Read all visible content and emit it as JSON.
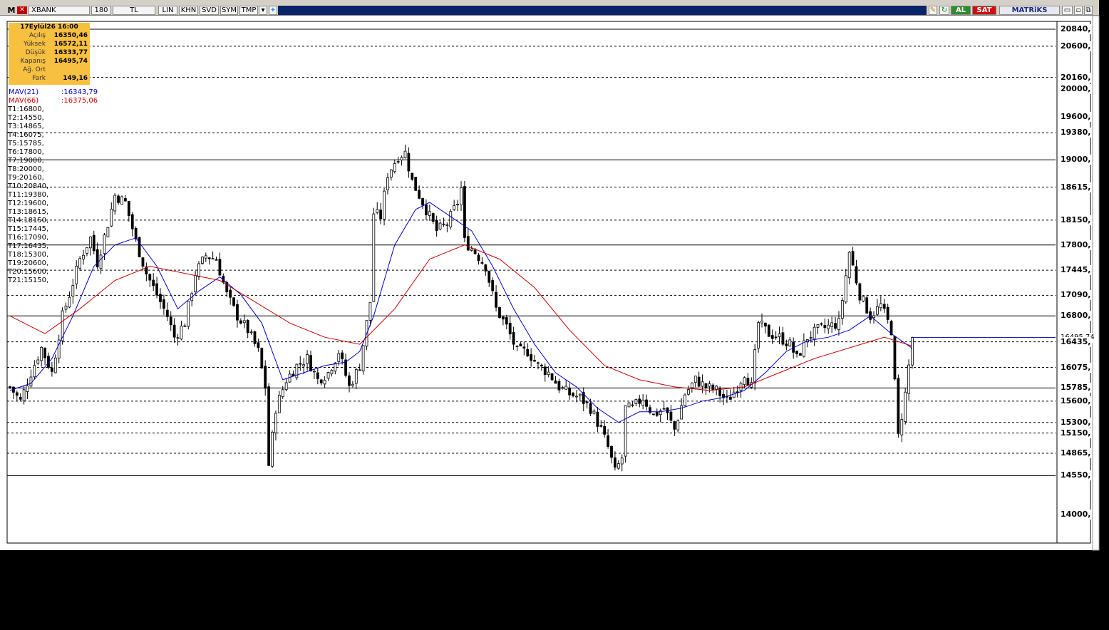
{
  "toolbar": {
    "app_letter": "M",
    "symbol": "XBANK",
    "period": "180",
    "currency": "TL",
    "buttons": [
      "LIN",
      "KHN",
      "SVD",
      "SYM",
      "TMP"
    ],
    "buy_label": "AL",
    "sell_label": "SAT",
    "brand": "MATRiKS"
  },
  "info": {
    "date": "17Eylül26 16:00",
    "rows": [
      {
        "label": "Açılış",
        "value": "16350,46"
      },
      {
        "label": "Yüksek",
        "value": "16572,11"
      },
      {
        "label": "Düşük",
        "value": "16333,77"
      },
      {
        "label": "Kapanış",
        "value": "16495,74"
      },
      {
        "label": "Ağ. Ort",
        "value": ""
      },
      {
        "label": "Fark",
        "value": "149,16"
      }
    ]
  },
  "indicators": [
    {
      "label": "MAV(21)",
      "value": ":16343,79",
      "color": "#0000cc"
    },
    {
      "label": "MAV(66)",
      "value": ":16375,06",
      "color": "#cc0000"
    }
  ],
  "level_list": [
    "T1:16800,",
    "T2:14550,",
    "T3:14865,",
    "T4:16075,",
    "T5:15785,",
    "T6:17800,",
    "T7:19000,",
    "T8:20000,",
    "T9:20160,",
    "T10:20840,",
    "T11:19380,",
    "T12:19600,",
    "T13:18615,",
    "T14:18150,",
    "T15:17445,",
    "T16:17090,",
    "T17:16435,",
    "T18:15300,",
    "T19:20600,",
    "T20:15600,",
    "T21:15150,"
  ],
  "chart_data": {
    "type": "candlestick",
    "symbol": "XBANK",
    "period": "180",
    "y_range": [
      13600,
      20950
    ],
    "axis_labels": [
      "20840,",
      "20600,",
      "20160,",
      "20000,",
      "19600,",
      "19380,",
      "19000,",
      "18615,",
      "18150,",
      "17800,",
      "17445,",
      "17090,",
      "16800,",
      "16495,74",
      "16435,",
      "16075,",
      "15785,",
      "15600,",
      "15300,",
      "15150,",
      "14865,",
      "14550,",
      "14000,"
    ],
    "solid_levels": [
      20840,
      19000,
      17800,
      16800,
      15785,
      14550
    ],
    "dashed_levels": [
      20600,
      20160,
      19380,
      18615,
      18150,
      17445,
      17090,
      16435,
      16075,
      15600,
      15300,
      15150,
      14865
    ],
    "last_close": 16495.74,
    "close_path": [
      [
        0,
        15800
      ],
      [
        3,
        15600
      ],
      [
        6,
        16000
      ],
      [
        9,
        16350
      ],
      [
        12,
        16000
      ],
      [
        15,
        16800
      ],
      [
        17,
        17100
      ],
      [
        20,
        17600
      ],
      [
        23,
        17900
      ],
      [
        25,
        17550
      ],
      [
        28,
        18100
      ],
      [
        30,
        18500
      ],
      [
        33,
        18400
      ],
      [
        36,
        17850
      ],
      [
        39,
        17400
      ],
      [
        42,
        17100
      ],
      [
        45,
        16800
      ],
      [
        47,
        16500
      ],
      [
        50,
        16700
      ],
      [
        53,
        17400
      ],
      [
        56,
        17650
      ],
      [
        59,
        17600
      ],
      [
        62,
        17100
      ],
      [
        65,
        16800
      ],
      [
        68,
        16600
      ],
      [
        71,
        16300
      ],
      [
        73,
        15800
      ],
      [
        74,
        14700
      ],
      [
        76,
        15500
      ],
      [
        79,
        15900
      ],
      [
        82,
        16100
      ],
      [
        85,
        16200
      ],
      [
        88,
        15900
      ],
      [
        91,
        16000
      ],
      [
        94,
        16300
      ],
      [
        97,
        15800
      ],
      [
        100,
        16100
      ],
      [
        102,
        16700
      ],
      [
        103,
        17000
      ],
      [
        104,
        18250
      ],
      [
        106,
        18200
      ],
      [
        108,
        18800
      ],
      [
        111,
        19050
      ],
      [
        113,
        19100
      ],
      [
        115,
        18700
      ],
      [
        117,
        18500
      ],
      [
        119,
        18300
      ],
      [
        122,
        18000
      ],
      [
        125,
        18100
      ],
      [
        128,
        18400
      ],
      [
        129,
        18600
      ],
      [
        130,
        17850
      ],
      [
        133,
        17700
      ],
      [
        136,
        17500
      ],
      [
        139,
        16900
      ],
      [
        142,
        16650
      ],
      [
        145,
        16300
      ],
      [
        148,
        16300
      ],
      [
        151,
        16100
      ],
      [
        154,
        16000
      ],
      [
        157,
        15800
      ],
      [
        160,
        15700
      ],
      [
        163,
        15650
      ],
      [
        166,
        15500
      ],
      [
        169,
        15200
      ],
      [
        171,
        14950
      ],
      [
        173,
        14600
      ],
      [
        175,
        14800
      ],
      [
        176,
        15500
      ],
      [
        178,
        15500
      ],
      [
        181,
        15650
      ],
      [
        184,
        15400
      ],
      [
        187,
        15500
      ],
      [
        190,
        15200
      ],
      [
        193,
        15700
      ],
      [
        196,
        15900
      ],
      [
        199,
        15800
      ],
      [
        202,
        15750
      ],
      [
        205,
        15600
      ],
      [
        208,
        15800
      ],
      [
        210,
        16000
      ],
      [
        212,
        15800
      ],
      [
        214,
        16700
      ],
      [
        217,
        16550
      ],
      [
        220,
        16500
      ],
      [
        223,
        16400
      ],
      [
        225,
        16200
      ],
      [
        228,
        16500
      ],
      [
        231,
        16600
      ],
      [
        234,
        16650
      ],
      [
        237,
        16700
      ],
      [
        240,
        17700
      ],
      [
        243,
        17100
      ],
      [
        246,
        16800
      ],
      [
        249,
        16950
      ],
      [
        252,
        16600
      ],
      [
        254,
        15100
      ],
      [
        256,
        15700
      ],
      [
        258,
        16495
      ]
    ],
    "series": [
      {
        "name": "MAV(21)",
        "color": "#0000cc",
        "points": [
          [
            0,
            15750
          ],
          [
            6,
            15850
          ],
          [
            12,
            16200
          ],
          [
            18,
            16800
          ],
          [
            24,
            17500
          ],
          [
            30,
            17800
          ],
          [
            36,
            17900
          ],
          [
            42,
            17500
          ],
          [
            48,
            16900
          ],
          [
            54,
            17150
          ],
          [
            60,
            17350
          ],
          [
            66,
            17100
          ],
          [
            72,
            16700
          ],
          [
            78,
            15900
          ],
          [
            84,
            16000
          ],
          [
            90,
            16100
          ],
          [
            96,
            16150
          ],
          [
            100,
            16300
          ],
          [
            104,
            16800
          ],
          [
            110,
            17800
          ],
          [
            116,
            18300
          ],
          [
            120,
            18400
          ],
          [
            126,
            18200
          ],
          [
            132,
            18000
          ],
          [
            138,
            17500
          ],
          [
            144,
            16900
          ],
          [
            150,
            16400
          ],
          [
            156,
            16000
          ],
          [
            162,
            15800
          ],
          [
            168,
            15500
          ],
          [
            174,
            15300
          ],
          [
            180,
            15450
          ],
          [
            186,
            15450
          ],
          [
            192,
            15500
          ],
          [
            198,
            15600
          ],
          [
            204,
            15650
          ],
          [
            210,
            15750
          ],
          [
            216,
            16000
          ],
          [
            222,
            16300
          ],
          [
            228,
            16450
          ],
          [
            234,
            16500
          ],
          [
            240,
            16600
          ],
          [
            246,
            16800
          ],
          [
            252,
            16550
          ],
          [
            258,
            16344
          ]
        ]
      },
      {
        "name": "MAV(66)",
        "color": "#cc0000",
        "points": [
          [
            0,
            16800
          ],
          [
            10,
            16550
          ],
          [
            20,
            16900
          ],
          [
            30,
            17300
          ],
          [
            40,
            17500
          ],
          [
            50,
            17400
          ],
          [
            60,
            17300
          ],
          [
            70,
            17000
          ],
          [
            80,
            16700
          ],
          [
            90,
            16500
          ],
          [
            100,
            16400
          ],
          [
            110,
            16900
          ],
          [
            120,
            17600
          ],
          [
            130,
            17800
          ],
          [
            140,
            17600
          ],
          [
            150,
            17200
          ],
          [
            160,
            16600
          ],
          [
            170,
            16100
          ],
          [
            180,
            15900
          ],
          [
            190,
            15800
          ],
          [
            200,
            15750
          ],
          [
            210,
            15800
          ],
          [
            220,
            16000
          ],
          [
            230,
            16200
          ],
          [
            240,
            16350
          ],
          [
            250,
            16500
          ],
          [
            258,
            16375
          ]
        ]
      }
    ]
  }
}
